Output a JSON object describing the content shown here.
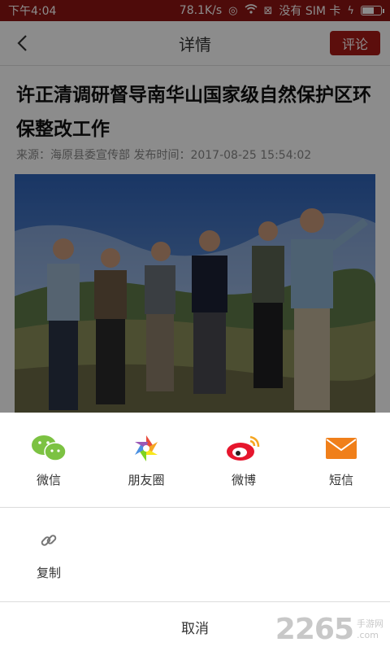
{
  "status_bar": {
    "time": "下午4:04",
    "speed": "78.1K/s",
    "no_service": "没有 SIM 卡"
  },
  "nav": {
    "title": "详情",
    "comment_label": "评论"
  },
  "article": {
    "title": "许正清调研督导南华山国家级自然保护区环保整改工作",
    "meta": "来源：海原县委宣传部 发布时间：2017-08-25 15:54:02"
  },
  "share_sheet": {
    "items": [
      {
        "label": "微信",
        "icon": "wechat-icon"
      },
      {
        "label": "朋友圈",
        "icon": "moments-icon"
      },
      {
        "label": "微博",
        "icon": "weibo-icon"
      },
      {
        "label": "短信",
        "icon": "sms-icon"
      }
    ],
    "copy_label": "复制",
    "cancel_label": "取消"
  },
  "watermark": {
    "number": "2265",
    "suffix": ".com",
    "site": "手游网"
  },
  "colors": {
    "brand_red": "#a81b16",
    "status_bar": "#8e1513"
  }
}
